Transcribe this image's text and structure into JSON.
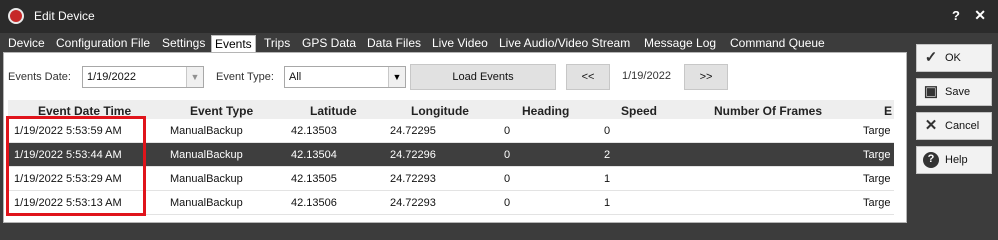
{
  "window": {
    "title": "Edit Device"
  },
  "tabs": [
    "Device",
    "Configuration File",
    "Settings",
    "Events",
    "Trips",
    "GPS Data",
    "Data Files",
    "Live Video",
    "Live Audio/Video Stream",
    "Message Log",
    "Command Queue"
  ],
  "active_tab": "Events",
  "toolbar": {
    "events_date_label": "Events Date:",
    "events_date_value": "1/19/2022",
    "event_type_label": "Event Type:",
    "event_type_value": "All",
    "load_button": "Load Events",
    "prev_button": "<<",
    "current_date": "1/19/2022",
    "next_button": ">>"
  },
  "grid": {
    "columns": [
      "Event Date Time",
      "Event Type",
      "Latitude",
      "Longitude",
      "Heading",
      "Speed",
      "Number Of Frames",
      "E"
    ],
    "rows": [
      {
        "datetime": "1/19/2022 5:53:59 AM",
        "type": "ManualBackup",
        "lat": "42.13503",
        "lon": "24.72295",
        "heading": "0",
        "speed": "0",
        "extra": "Targe"
      },
      {
        "datetime": "1/19/2022 5:53:44 AM",
        "type": "ManualBackup",
        "lat": "42.13504",
        "lon": "24.72296",
        "heading": "0",
        "speed": "2",
        "extra": "Targe"
      },
      {
        "datetime": "1/19/2022 5:53:29 AM",
        "type": "ManualBackup",
        "lat": "42.13505",
        "lon": "24.72293",
        "heading": "0",
        "speed": "1",
        "extra": "Targe"
      },
      {
        "datetime": "1/19/2022 5:53:13 AM",
        "type": "ManualBackup",
        "lat": "42.13506",
        "lon": "24.72293",
        "heading": "0",
        "speed": "1",
        "extra": "Targe"
      }
    ],
    "selected_row_index": 1
  },
  "side": {
    "ok": "OK",
    "save": "Save",
    "cancel": "Cancel",
    "help": "Help"
  },
  "colors": {
    "highlight": "#e0141b",
    "selected_row": "#3e3e3e",
    "chrome": "#3c3c3c"
  }
}
